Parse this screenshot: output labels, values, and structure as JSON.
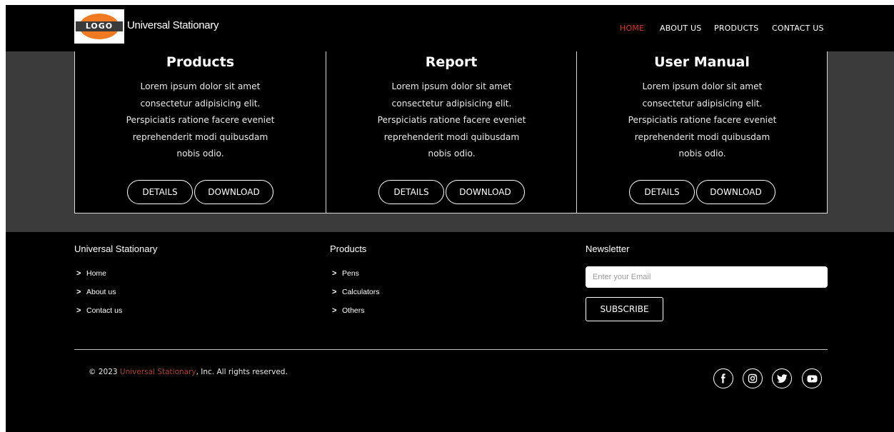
{
  "header": {
    "logo_text": "LOGO",
    "brand": "Universal Stationary",
    "nav": [
      {
        "label": "HOME",
        "active": true
      },
      {
        "label": "ABOUT US",
        "active": false
      },
      {
        "label": "PRODUCTS",
        "active": false
      },
      {
        "label": "CONTACT US",
        "active": false
      }
    ]
  },
  "cards": [
    {
      "title": "Products",
      "body": "Lorem ipsum dolor sit amet consectetur adipisicing elit. Perspiciatis ratione facere eveniet reprehenderit modi quibusdam nobis odio.",
      "details_label": "DETAILS",
      "download_label": "DOWNLOAD"
    },
    {
      "title": "Report",
      "body": "Lorem ipsum dolor sit amet consectetur adipisicing elit. Perspiciatis ratione facere eveniet reprehenderit modi quibusdam nobis odio.",
      "details_label": "DETAILS",
      "download_label": "DOWNLOAD"
    },
    {
      "title": "User Manual",
      "body": "Lorem ipsum dolor sit amet consectetur adipisicing elit. Perspiciatis ratione facere eveniet reprehenderit modi quibusdam nobis odio.",
      "details_label": "DETAILS",
      "download_label": "DOWNLOAD"
    }
  ],
  "footer": {
    "company": {
      "title": "Universal Stationary",
      "links": [
        "Home",
        "About us",
        "Contact us"
      ]
    },
    "products": {
      "title": "Products",
      "links": [
        "Pens",
        "Calculators",
        "Others"
      ]
    },
    "newsletter": {
      "title": "Newsletter",
      "email_placeholder": "Enter your Email",
      "subscribe_label": "SUBSCRIBE"
    },
    "copyright": {
      "prefix": "© 2023 ",
      "brand": "Universal Stationary",
      "suffix": ", Inc. All rights reserved."
    },
    "social_icons": [
      "facebook-icon",
      "instagram-icon",
      "twitter-icon",
      "youtube-icon"
    ]
  },
  "colors": {
    "accent": "#e8302d",
    "page_bg": "#000000",
    "band_bg": "#3b3b3b"
  }
}
